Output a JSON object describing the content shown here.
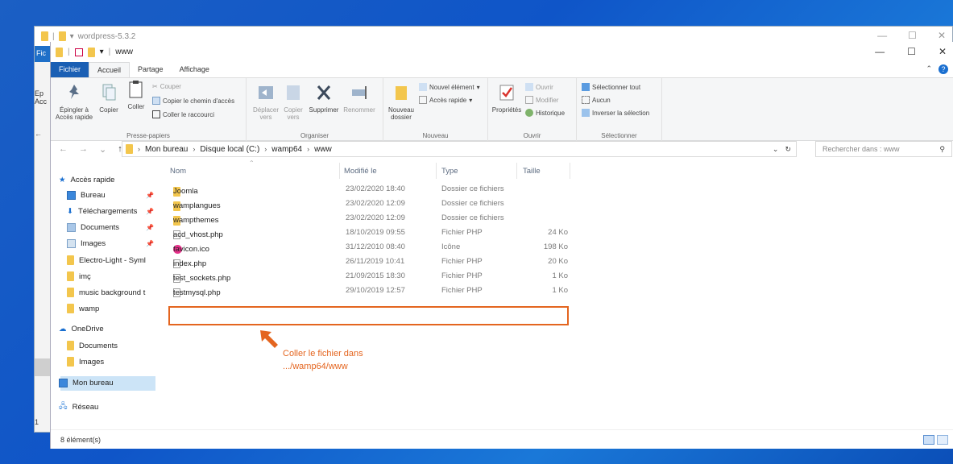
{
  "back_window": {
    "title": "wordpress-5.3.2",
    "tab": "Fic",
    "side_texts": [
      "Ep",
      "Acc",
      "1"
    ]
  },
  "window": {
    "title": "www",
    "tabs": [
      "Fichier",
      "Accueil",
      "Partage",
      "Affichage"
    ],
    "ribbon": {
      "presse_papiers": {
        "name": "Presse-papiers",
        "epingler": "Épingler à Accès rapide",
        "copier": "Copier",
        "coller": "Coller",
        "couper": "Couper",
        "copier_chemin": "Copier le chemin d'accès",
        "coller_raccourci": "Coller le raccourci"
      },
      "organiser": {
        "name": "Organiser",
        "deplacer": "Déplacer vers",
        "copier_vers": "Copier vers",
        "supprimer": "Supprimer",
        "renommer": "Renommer"
      },
      "nouveau": {
        "name": "Nouveau",
        "nouveau_dossier": "Nouveau dossier",
        "nouvel_element": "Nouvel élément",
        "acces_rapide": "Accès rapide"
      },
      "ouvrir": {
        "name": "Ouvrir",
        "proprietes": "Propriétés",
        "ouvrir": "Ouvrir",
        "modifier": "Modifier",
        "historique": "Historique"
      },
      "selectionner": {
        "name": "Sélectionner",
        "tout": "Sélectionner tout",
        "aucun": "Aucun",
        "inverser": "Inverser la sélection"
      }
    },
    "address": {
      "segments": [
        "Mon bureau",
        "Disque local (C:)",
        "wamp64",
        "www"
      ]
    },
    "search_placeholder": "Rechercher dans : www",
    "navpane": {
      "quick_access": "Accès rapide",
      "items": [
        "Bureau",
        "Téléchargements",
        "Documents",
        "Images",
        "Electro-Light - Syml",
        "imç",
        "music background t",
        "wamp"
      ],
      "onedrive": "OneDrive",
      "onedrive_items": [
        "Documents",
        "Images"
      ],
      "mon_bureau": "Mon bureau",
      "reseau": "Réseau"
    },
    "columns": [
      "Nom",
      "Modifié le",
      "Type",
      "Taille"
    ],
    "files": [
      {
        "name": "Joomla",
        "date": "23/02/2020 18:40",
        "type": "Dossier ce fichiers",
        "size": "",
        "icon": "folder-icon"
      },
      {
        "name": "wamplangues",
        "date": "23/02/2020 12:09",
        "type": "Dossier ce fichiers",
        "size": "",
        "icon": "folder-icon"
      },
      {
        "name": "wampthemes",
        "date": "23/02/2020 12:09",
        "type": "Dossier ce fichiers",
        "size": "",
        "icon": "folder-icon"
      },
      {
        "name": "acd_vhost.php",
        "date": "18/10/2019 09:55",
        "type": "Fichier PHP",
        "size": "24 Ko",
        "icon": "file-icon"
      },
      {
        "name": "favicon.ico",
        "date": "31/12/2010 08:40",
        "type": "Icône",
        "size": "198 Ko",
        "icon": "favicon-icon"
      },
      {
        "name": "index.php",
        "date": "26/11/2019 10:41",
        "type": "Fichier PHP",
        "size": "20 Ko",
        "icon": "file-icon"
      },
      {
        "name": "test_sockets.php",
        "date": "21/09/2015 18:30",
        "type": "Fichier PHP",
        "size": "1 Ko",
        "icon": "file-icon"
      },
      {
        "name": "testmysql.php",
        "date": "29/10/2019 12:57",
        "type": "Fichier PHP",
        "size": "1 Ko",
        "icon": "file-icon"
      }
    ],
    "annotation": [
      "Coller le fichier dans",
      ".../wamp64/www"
    ],
    "status": "8 élément(s)"
  }
}
